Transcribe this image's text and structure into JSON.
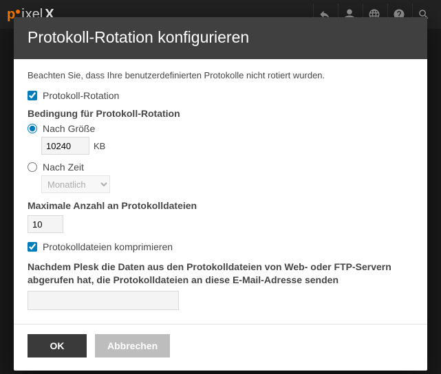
{
  "topbar": {
    "logo_parts": {
      "p1": "p",
      "p2": "i",
      "p3": "xel",
      "p4": "X"
    }
  },
  "dialog": {
    "title": "Protokoll-Rotation konfigurieren",
    "hint": "Beachten Sie, dass Ihre benutzerdefinierten Protokolle nicht rotiert wurden.",
    "enable_label": "Protokoll-Rotation",
    "enable_checked": true,
    "condition_heading": "Bedingung für Protokoll-Rotation",
    "by_size_label": "Nach Größe",
    "by_size_value": "10240",
    "by_size_unit": "KB",
    "condition_selected": "size",
    "by_time_label": "Nach Zeit",
    "by_time_value": "Monatlich",
    "max_files_label": "Maximale Anzahl an Protokolldateien",
    "max_files_value": "10",
    "compress_label": "Protokolldateien komprimieren",
    "compress_checked": true,
    "email_label": "Nachdem Plesk die Daten aus den Protokolldateien von Web- oder FTP-Servern abgerufen hat, die Protokolldateien an diese E-Mail-Adresse senden",
    "email_value": ""
  },
  "buttons": {
    "ok": "OK",
    "cancel": "Abbrechen"
  }
}
